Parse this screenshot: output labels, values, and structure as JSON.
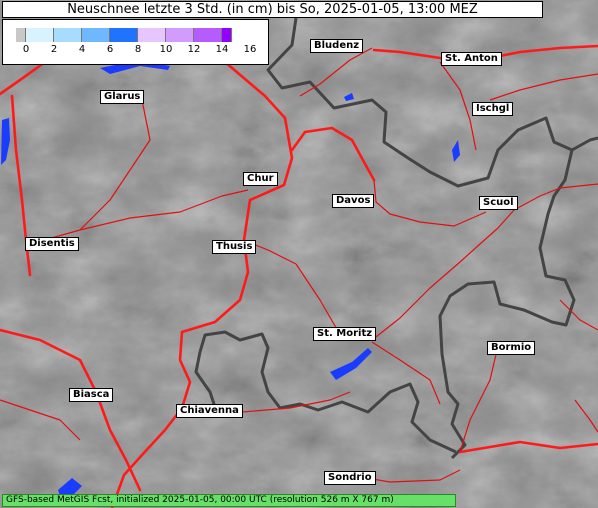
{
  "title": "Neuschnee letzte 3 Std. (in cm) bis So, 2025-01-05, 13:00 MEZ",
  "legend": {
    "ticks": [
      "0",
      "2",
      "4",
      "6",
      "8",
      "10",
      "12",
      "14",
      "16"
    ],
    "colors": [
      "#c8c8c8",
      "#d9f2ff",
      "#a8dcff",
      "#6fb8ff",
      "#1f73ff",
      "#e6c6ff",
      "#d29cff",
      "#b65cff",
      "#9400ff"
    ]
  },
  "cities": [
    {
      "id": "bludenz",
      "name": "Bludenz"
    },
    {
      "id": "st-anton",
      "name": "St. Anton"
    },
    {
      "id": "glarus",
      "name": "Glarus"
    },
    {
      "id": "ischgl",
      "name": "Ischgl"
    },
    {
      "id": "chur",
      "name": "Chur"
    },
    {
      "id": "davos",
      "name": "Davos"
    },
    {
      "id": "scuol",
      "name": "Scuol"
    },
    {
      "id": "disentis",
      "name": "Disentis"
    },
    {
      "id": "thusis",
      "name": "Thusis"
    },
    {
      "id": "st-moritz",
      "name": "St. Moritz"
    },
    {
      "id": "bormio",
      "name": "Bormio"
    },
    {
      "id": "biasca",
      "name": "Biasca"
    },
    {
      "id": "chiavenna",
      "name": "Chiavenna"
    },
    {
      "id": "sondrio",
      "name": "Sondrio"
    }
  ],
  "footer": "GFS-based MetGIS Fcst, initialized 2025-01-05, 00:00 UTC  (resolution 526 m X 767 m)",
  "colors": {
    "road": "#ff1a1a",
    "border": "#444444",
    "water": "#1a3cff",
    "terrain": "#8a8a8a"
  }
}
